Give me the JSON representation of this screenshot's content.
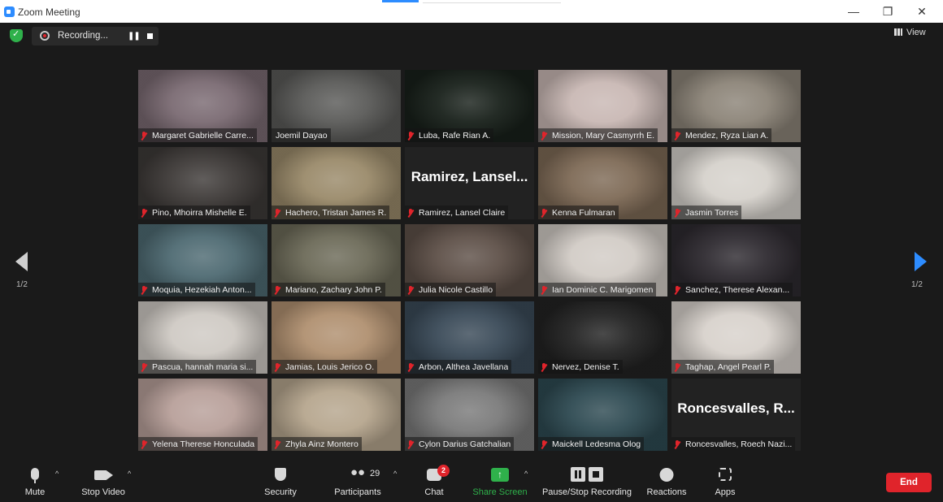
{
  "window": {
    "title": "Zoom Meeting",
    "minimize": "—",
    "restore": "❐",
    "close": "✕"
  },
  "recording": {
    "status": "Recording...",
    "pause": "❚❚"
  },
  "view": {
    "label": "View"
  },
  "pagination": {
    "left": "1/2",
    "right": "1/2"
  },
  "participants_grid": [
    {
      "name": "Margaret Gabrielle Carre...",
      "bg": "#7a6a72",
      "active": false
    },
    {
      "name": "Joemil Dayao",
      "bg": "#5a5a58",
      "active": true
    },
    {
      "name": "Luba, Rafe Rian A.",
      "bg": "#18201a",
      "active": false
    },
    {
      "name": "Mission, Mary Casmyrrh E.",
      "bg": "#c9b8b4",
      "active": false
    },
    {
      "name": "Mendez, Ryza Lian A.",
      "bg": "#8c8478",
      "active": false
    },
    {
      "name": "Pino, Mhoirra Mishelle E.",
      "bg": "#3e3a38",
      "active": false
    },
    {
      "name": "Hachero, Tristan James R.",
      "bg": "#9a8a6a",
      "active": false
    },
    {
      "name": "Ramirez, Lansel Claire",
      "bg": "#222222",
      "active": false,
      "big": "Ramirez, Lansel..."
    },
    {
      "name": "Kenna Fulmaran",
      "bg": "#7e6a56",
      "active": false
    },
    {
      "name": "Jasmin Torres",
      "bg": "#d6d2cc",
      "active": false
    },
    {
      "name": "Moquia, Hezekiah Anton...",
      "bg": "#4e6a72",
      "active": false
    },
    {
      "name": "Mariano, Zachary John P.",
      "bg": "#6c6a58",
      "active": false
    },
    {
      "name": "Julia Nicole Castillo",
      "bg": "#5e5048",
      "active": false
    },
    {
      "name": "Ian Dominic C. Marigomen",
      "bg": "#d2ccc6",
      "active": false
    },
    {
      "name": "Sanchez, Therese Alexan...",
      "bg": "#2e2a30",
      "active": false
    },
    {
      "name": "Pascua, hannah maria si...",
      "bg": "#cfcac4",
      "active": false
    },
    {
      "name": "Jamias, Louis Jerico O.",
      "bg": "#b09070",
      "active": false
    },
    {
      "name": "Arbon, Althea Javellana",
      "bg": "#3a4a58",
      "active": false
    },
    {
      "name": "Nervez, Denise T.",
      "bg": "#222222",
      "active": false
    },
    {
      "name": "Taghap, Angel Pearl P.",
      "bg": "#d8d2cc",
      "active": false
    },
    {
      "name": "Yelena Therese Honculada",
      "bg": "#b8a09a",
      "active": false
    },
    {
      "name": "Zhyla Ainz Montero",
      "bg": "#b6a68e",
      "active": false
    },
    {
      "name": "Cylon Darius Gatchalian",
      "bg": "#7a7a7a",
      "active": false
    },
    {
      "name": "Maickell Ledesma Olog",
      "bg": "#2e4a52",
      "active": false
    },
    {
      "name": "Roncesvalles, Roech Nazi...",
      "bg": "#222222",
      "active": false,
      "big": "Roncesvalles, R..."
    }
  ],
  "toolbar": {
    "mute": "Mute",
    "stop_video": "Stop Video",
    "security": "Security",
    "participants": "Participants",
    "participants_count": "29",
    "chat": "Chat",
    "chat_badge": "2",
    "share_screen": "Share Screen",
    "pause_stop_recording": "Pause/Stop Recording",
    "reactions": "Reactions",
    "apps": "Apps",
    "end": "End",
    "caret": "^"
  },
  "colors": {
    "accent": "#2d8cff",
    "active_speaker": "#c8e04f",
    "share_green": "#2fb14b",
    "end_red": "#e0242b"
  },
  "icons": [
    "zoom-logo-icon",
    "shield-check-icon",
    "record-icon",
    "pause-icon",
    "stop-icon",
    "grid-view-icon",
    "arrow-left-icon",
    "arrow-right-icon",
    "mic-muted-icon",
    "mic-icon",
    "video-icon",
    "shield-icon",
    "people-icon",
    "chat-icon",
    "share-screen-icon",
    "recording-controls-icon",
    "reaction-icon",
    "apps-icon"
  ]
}
